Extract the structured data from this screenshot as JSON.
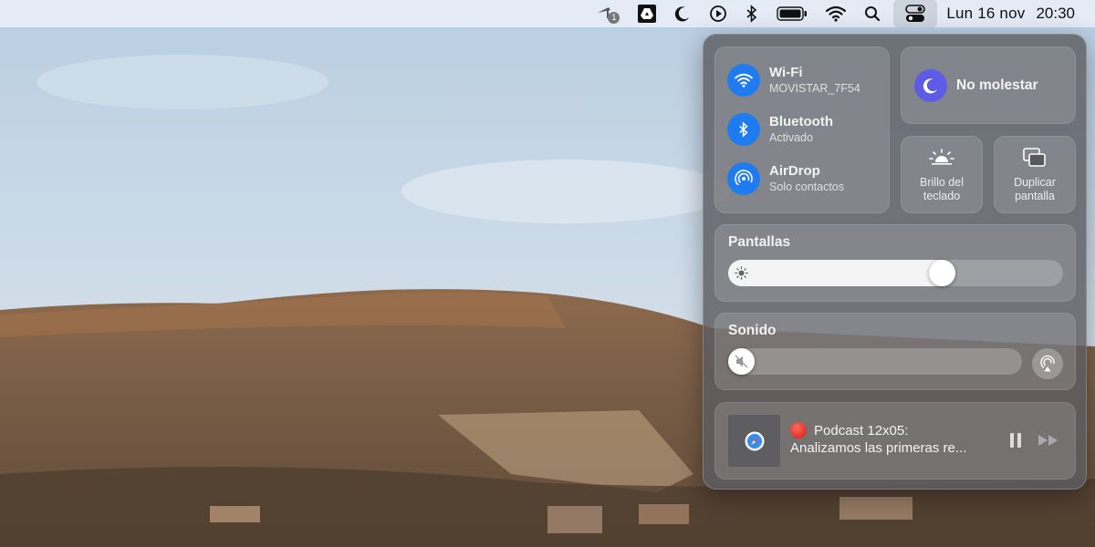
{
  "menubar": {
    "notification_badge": "1",
    "date": "Lun 16 nov",
    "time": "20:30",
    "icons": [
      "weather-app-icon",
      "google-drive-icon",
      "moon-icon",
      "play-circle-icon",
      "bluetooth-icon",
      "battery-icon",
      "wifi-icon",
      "search-icon",
      "control-center-icon"
    ]
  },
  "control_center": {
    "wifi": {
      "title": "Wi-Fi",
      "subtitle": "MOVISTAR_7F54",
      "icon": "wifi-icon"
    },
    "bluetooth": {
      "title": "Bluetooth",
      "subtitle": "Activado",
      "icon": "bluetooth-icon"
    },
    "airdrop": {
      "title": "AirDrop",
      "subtitle": "Solo contactos",
      "icon": "airdrop-icon"
    },
    "do_not_disturb": {
      "label": "No molestar",
      "icon": "moon-icon"
    },
    "keyboard_brightness": {
      "line1": "Brillo del",
      "line2": "teclado",
      "icon": "keyboard-brightness-icon"
    },
    "screen_mirroring": {
      "line1": "Duplicar",
      "line2": "pantalla",
      "icon": "screen-mirroring-icon"
    },
    "display": {
      "title": "Pantallas",
      "level": 0.65,
      "icon": "sun-icon"
    },
    "sound": {
      "title": "Sonido",
      "level": 0.0,
      "icon": "speaker-muted-icon",
      "airplay_icon": "airplay-audio-icon"
    },
    "now_playing": {
      "title": "Podcast 12x05:",
      "subtitle": "Analizamos las primeras re...",
      "art_icon": "safari-icon",
      "pause_icon": "pause-icon",
      "forward_icon": "fast-forward-icon"
    }
  },
  "colors": {
    "accent_blue": "#1f7cf0",
    "dnd_purple": "#5e5ce6",
    "record_red": "#d01a10"
  }
}
